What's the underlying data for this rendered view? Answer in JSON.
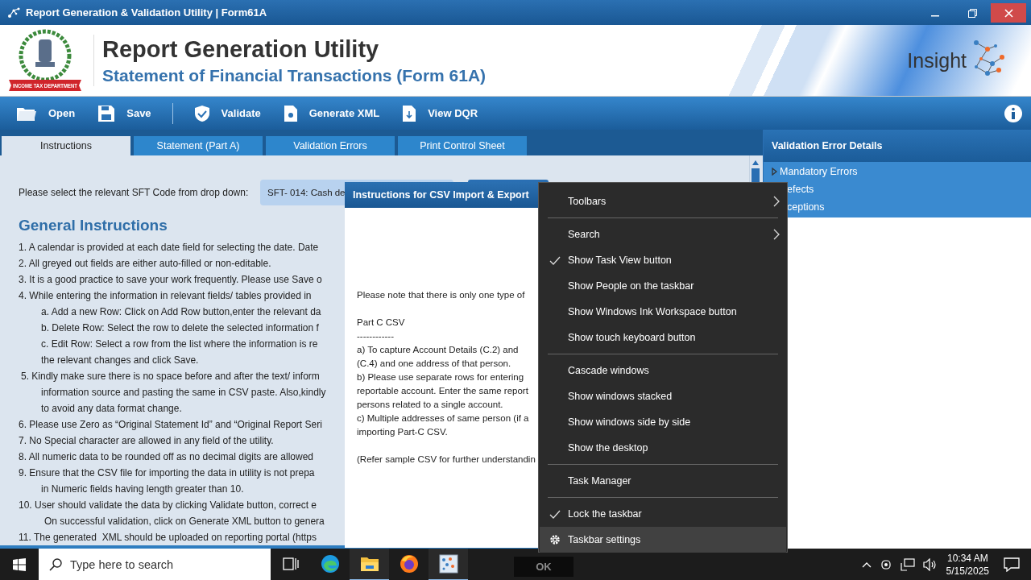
{
  "window": {
    "title": "Report Generation & Validation Utility | Form61A"
  },
  "header": {
    "emblem_text": "INCOME TAX DEPARTMENT",
    "title": "Report Generation Utility",
    "subtitle": "Statement of Financial Transactions (Form 61A)",
    "brand": "Insight"
  },
  "toolbar": [
    {
      "kind": "open",
      "label": "Open"
    },
    {
      "kind": "save",
      "label": "Save"
    },
    {
      "kind": "separator"
    },
    {
      "kind": "validate",
      "label": "Validate"
    },
    {
      "kind": "xml",
      "label": "Generate XML"
    },
    {
      "kind": "dqr",
      "label": "View DQR"
    }
  ],
  "tabs": [
    {
      "label": "Instructions",
      "selected": true
    },
    {
      "label": "Statement (Part A)",
      "selected": false
    },
    {
      "label": "Validation Errors",
      "selected": false
    },
    {
      "label": "Print Control Sheet",
      "selected": false
    }
  ],
  "sft": {
    "label": "Please select the relevant SFT Code from drop down:",
    "value": "SFT- 014: Cash de"
  },
  "instructions": {
    "heading": "General Instructions",
    "lines": [
      {
        "kind": "item",
        "text": "1. A calendar is provided at each date field for selecting the date. Date"
      },
      {
        "kind": "item",
        "text": "2. All greyed out fields are either auto-filled or non-editable."
      },
      {
        "kind": "item",
        "text": "3. It is a good practice to save your work frequently. Please use Save o"
      },
      {
        "kind": "item",
        "text": "4. While entering the information in relevant fields/ tables provided in"
      },
      {
        "kind": "sub",
        "text": "a. Add a new Row: Click on Add Row button,enter the relevant da"
      },
      {
        "kind": "sub",
        "text": "b. Delete Row: Select the row to delete the selected information f"
      },
      {
        "kind": "sub",
        "text": "c. Edit Row: Select a row from the list where the information is re"
      },
      {
        "kind": "sub",
        "text": "the relevant changes and click Save."
      },
      {
        "kind": "shifted",
        "text": "5. Kindly make sure there is no space before and after the text/ inform"
      },
      {
        "kind": "sub",
        "text": "information source and pasting the same in CSV paste. Also,kindly"
      },
      {
        "kind": "sub",
        "text": "to avoid any data format change."
      },
      {
        "kind": "item",
        "text": "6. Please use Zero as “Original Statement Id” and “Original Report Seri"
      },
      {
        "kind": "item",
        "text": "7. No Special character are allowed in any field of the utility."
      },
      {
        "kind": "item",
        "text": "8. All numeric data to be rounded off as no decimal digits are allowed"
      },
      {
        "kind": "item",
        "text": "9. Ensure that the CSV file for importing the data in utility is not prepa"
      },
      {
        "kind": "sub",
        "text": "in Numeric fields having length greater than 10."
      },
      {
        "kind": "item",
        "text": "10. User should validate the data by clicking Validate button, correct e"
      },
      {
        "kind": "deep",
        "text": "On successful validation, click on Generate XML button to genera"
      },
      {
        "kind": "item",
        "text": "11. The generated  XML should be uploaded on reporting portal (https"
      }
    ]
  },
  "error_panel": {
    "title": "Validation Error Details",
    "items": [
      {
        "label": "Mandatory Errors",
        "expanded": false
      },
      {
        "label": "efects"
      },
      {
        "label": "ceptions"
      }
    ]
  },
  "dialog": {
    "title": "Instructions for CSV Import & Export",
    "lines": [
      {
        "kind": "text",
        "text": "Please note that there is only one type of"
      },
      {
        "kind": "blank"
      },
      {
        "kind": "text",
        "text": "Part C CSV"
      },
      {
        "kind": "text",
        "text": "------------"
      },
      {
        "kind": "text",
        "text": "a) To capture Account Details (C.2) and"
      },
      {
        "kind": "text",
        "text": "(C.4) and one address of that person."
      },
      {
        "kind": "text",
        "text": "b) Please use separate rows for entering"
      },
      {
        "kind": "text",
        "text": "reportable account. Enter the same report"
      },
      {
        "kind": "text",
        "text": "persons related to a single account."
      },
      {
        "kind": "text",
        "text": "c) Multiple addresses of same person (if a"
      },
      {
        "kind": "text",
        "text": "importing Part-C CSV."
      },
      {
        "kind": "blank"
      },
      {
        "kind": "text",
        "text": "(Refer sample CSV for further understandin"
      }
    ],
    "ok_button": "OK"
  },
  "context_menu": {
    "items": [
      {
        "kind": "item",
        "label": "Toolbars",
        "checked": false,
        "submenu": true,
        "selected": false
      },
      {
        "kind": "separator"
      },
      {
        "kind": "item",
        "label": "Search",
        "checked": false,
        "submenu": true,
        "selected": false
      },
      {
        "kind": "item",
        "label": "Show Task View button",
        "checked": true,
        "submenu": false,
        "selected": false
      },
      {
        "kind": "item",
        "label": "Show People on the taskbar",
        "checked": false,
        "submenu": false,
        "selected": false
      },
      {
        "kind": "item",
        "label": "Show Windows Ink Workspace button",
        "checked": false,
        "submenu": false,
        "selected": false
      },
      {
        "kind": "item",
        "label": "Show touch keyboard button",
        "checked": false,
        "submenu": false,
        "selected": false
      },
      {
        "kind": "separator"
      },
      {
        "kind": "item",
        "label": "Cascade windows",
        "checked": false,
        "submenu": false,
        "selected": false
      },
      {
        "kind": "item",
        "label": "Show windows stacked",
        "checked": false,
        "submenu": false,
        "selected": false
      },
      {
        "kind": "item",
        "label": "Show windows side by side",
        "checked": false,
        "submenu": false,
        "selected": false
      },
      {
        "kind": "item",
        "label": "Show the desktop",
        "checked": false,
        "submenu": false,
        "selected": false
      },
      {
        "kind": "separator"
      },
      {
        "kind": "item",
        "label": "Task Manager",
        "checked": false,
        "submenu": false,
        "selected": false
      },
      {
        "kind": "separator"
      },
      {
        "kind": "item",
        "label": "Lock the taskbar",
        "checked": true,
        "submenu": false,
        "selected": false
      },
      {
        "kind": "settings",
        "label": "Taskbar settings",
        "checked": false,
        "submenu": false,
        "selected": true
      }
    ]
  },
  "taskbar": {
    "search_placeholder": "Type here to search",
    "apps": [
      {
        "kind": "taskview",
        "active": false
      },
      {
        "kind": "edge",
        "active": false
      },
      {
        "kind": "explorer",
        "active": true
      },
      {
        "kind": "firefox",
        "active": false
      },
      {
        "kind": "utility",
        "active": true
      }
    ],
    "time": "10:34 AM",
    "date": "5/15/2025"
  }
}
